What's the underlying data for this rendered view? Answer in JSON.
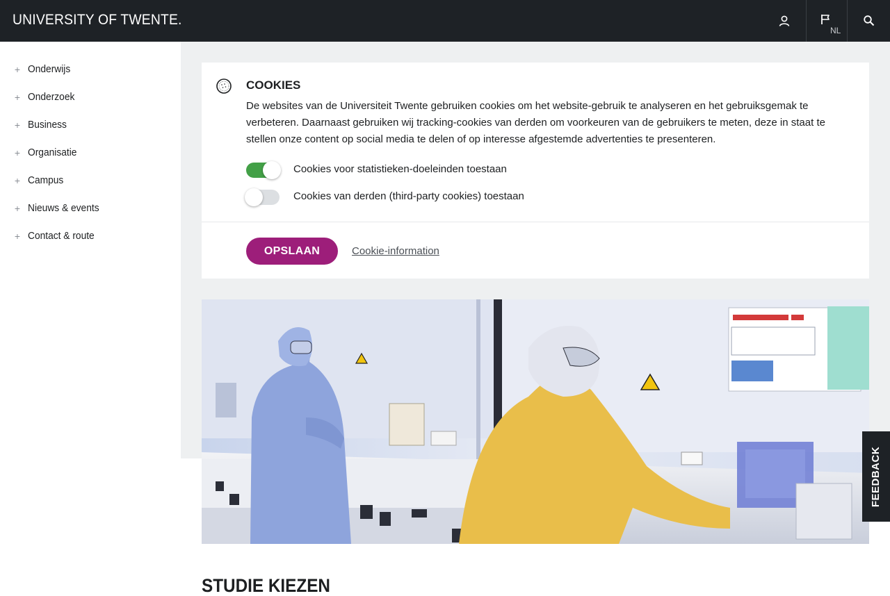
{
  "header": {
    "logo_text": "UNIVERSITY OF TWENTE.",
    "user_icon": "user-icon",
    "language_icon": "flag-icon",
    "language_code": "NL",
    "search_icon": "search-icon"
  },
  "sidebar": {
    "items": [
      {
        "label": "Onderwijs"
      },
      {
        "label": "Onderzoek"
      },
      {
        "label": "Business"
      },
      {
        "label": "Organisatie"
      },
      {
        "label": "Campus"
      },
      {
        "label": "Nieuws & events"
      },
      {
        "label": "Contact & route"
      }
    ],
    "expand_icon": "plus-icon"
  },
  "cookies": {
    "icon": "cookie-icon",
    "title": "COOKIES",
    "description": "De websites van de Universiteit Twente gebruiken cookies om het website-gebruik te analyseren en het gebruiksgemak te verbeteren. Daarnaast gebruiken wij tracking-cookies van derden om voorkeuren van de gebruikers te meten, deze in staat te stellen onze content op social media te delen of op interesse afgestemde advertenties te presenteren.",
    "toggles": [
      {
        "label": "Cookies voor statistieken-doeleinden toestaan",
        "enabled": true
      },
      {
        "label": "Cookies van derden (third-party cookies) toestaan",
        "enabled": false
      }
    ],
    "save_label": "OPSLAAN",
    "info_link": "Cookie-information"
  },
  "main": {
    "section_title": "STUDIE KIEZEN"
  },
  "feedback": {
    "label": "FEEDBACK"
  },
  "colors": {
    "header_bg": "#1e2226",
    "accent": "#9d1e7a",
    "toggle_on": "#43a047",
    "page_bg": "#eef0f1"
  }
}
